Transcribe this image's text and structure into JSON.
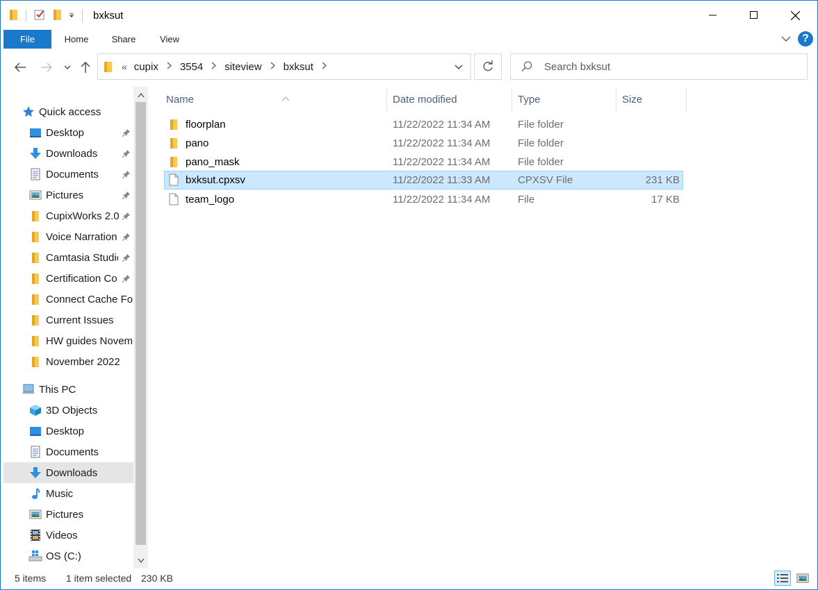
{
  "window": {
    "title": "bxksut"
  },
  "ribbon": {
    "tabs": [
      {
        "label": "File"
      },
      {
        "label": "Home"
      },
      {
        "label": "Share"
      },
      {
        "label": "View"
      }
    ],
    "help_label": "?"
  },
  "address": {
    "overflow": "«",
    "crumbs": [
      "cupix",
      "3554",
      "siteview",
      "bxksut"
    ]
  },
  "search": {
    "placeholder": "Search bxksut"
  },
  "nav": {
    "quick_access_label": "Quick access",
    "quick_items": [
      {
        "label": "Desktop",
        "icon": "desktop-icon",
        "pinned": true
      },
      {
        "label": "Downloads",
        "icon": "download-icon",
        "pinned": true
      },
      {
        "label": "Documents",
        "icon": "documents-icon",
        "pinned": true
      },
      {
        "label": "Pictures",
        "icon": "pictures-icon",
        "pinned": true
      },
      {
        "label": "CupixWorks 2.0",
        "icon": "folder-icon",
        "pinned": true
      },
      {
        "label": "Voice Narration",
        "icon": "folder-icon",
        "pinned": true
      },
      {
        "label": "Camtasia Studio",
        "icon": "folder-icon",
        "pinned": true
      },
      {
        "label": "Certification Co",
        "icon": "folder-icon",
        "pinned": true
      },
      {
        "label": "Connect Cache Fol",
        "icon": "folder-icon",
        "pinned": false
      },
      {
        "label": "Current Issues",
        "icon": "folder-icon",
        "pinned": false
      },
      {
        "label": "HW guides Novem",
        "icon": "folder-icon",
        "pinned": false
      },
      {
        "label": "November 2022",
        "icon": "folder-icon",
        "pinned": false
      }
    ],
    "this_pc_label": "This PC",
    "pc_items": [
      {
        "label": "3D Objects",
        "icon": "3d-objects-icon"
      },
      {
        "label": "Desktop",
        "icon": "desktop-icon"
      },
      {
        "label": "Documents",
        "icon": "documents-icon"
      },
      {
        "label": "Downloads",
        "icon": "download-icon",
        "selected": true
      },
      {
        "label": "Music",
        "icon": "music-icon"
      },
      {
        "label": "Pictures",
        "icon": "pictures-icon"
      },
      {
        "label": "Videos",
        "icon": "videos-icon"
      },
      {
        "label": "OS (C:)",
        "icon": "drive-icon"
      }
    ]
  },
  "columns": {
    "name": "Name",
    "date": "Date modified",
    "type": "Type",
    "size": "Size"
  },
  "files": [
    {
      "name": "floorplan",
      "date": "11/22/2022 11:34 AM",
      "type": "File folder",
      "size": "",
      "kind": "folder"
    },
    {
      "name": "pano",
      "date": "11/22/2022 11:34 AM",
      "type": "File folder",
      "size": "",
      "kind": "folder"
    },
    {
      "name": "pano_mask",
      "date": "11/22/2022 11:34 AM",
      "type": "File folder",
      "size": "",
      "kind": "folder"
    },
    {
      "name": "bxksut.cpxsv",
      "date": "11/22/2022 11:33 AM",
      "type": "CPXSV File",
      "size": "231 KB",
      "kind": "file",
      "selected": true
    },
    {
      "name": "team_logo",
      "date": "11/22/2022 11:34 AM",
      "type": "File",
      "size": "17 KB",
      "kind": "file"
    }
  ],
  "status": {
    "count": "5 items",
    "selection": "1 item selected",
    "selection_size": "230 KB"
  },
  "colors": {
    "accent": "#1979ca",
    "folder": "#f8c94c",
    "selected_row": "#cce8ff",
    "selected_border": "#99d1ff",
    "nav_selected": "#e5e5e5"
  }
}
